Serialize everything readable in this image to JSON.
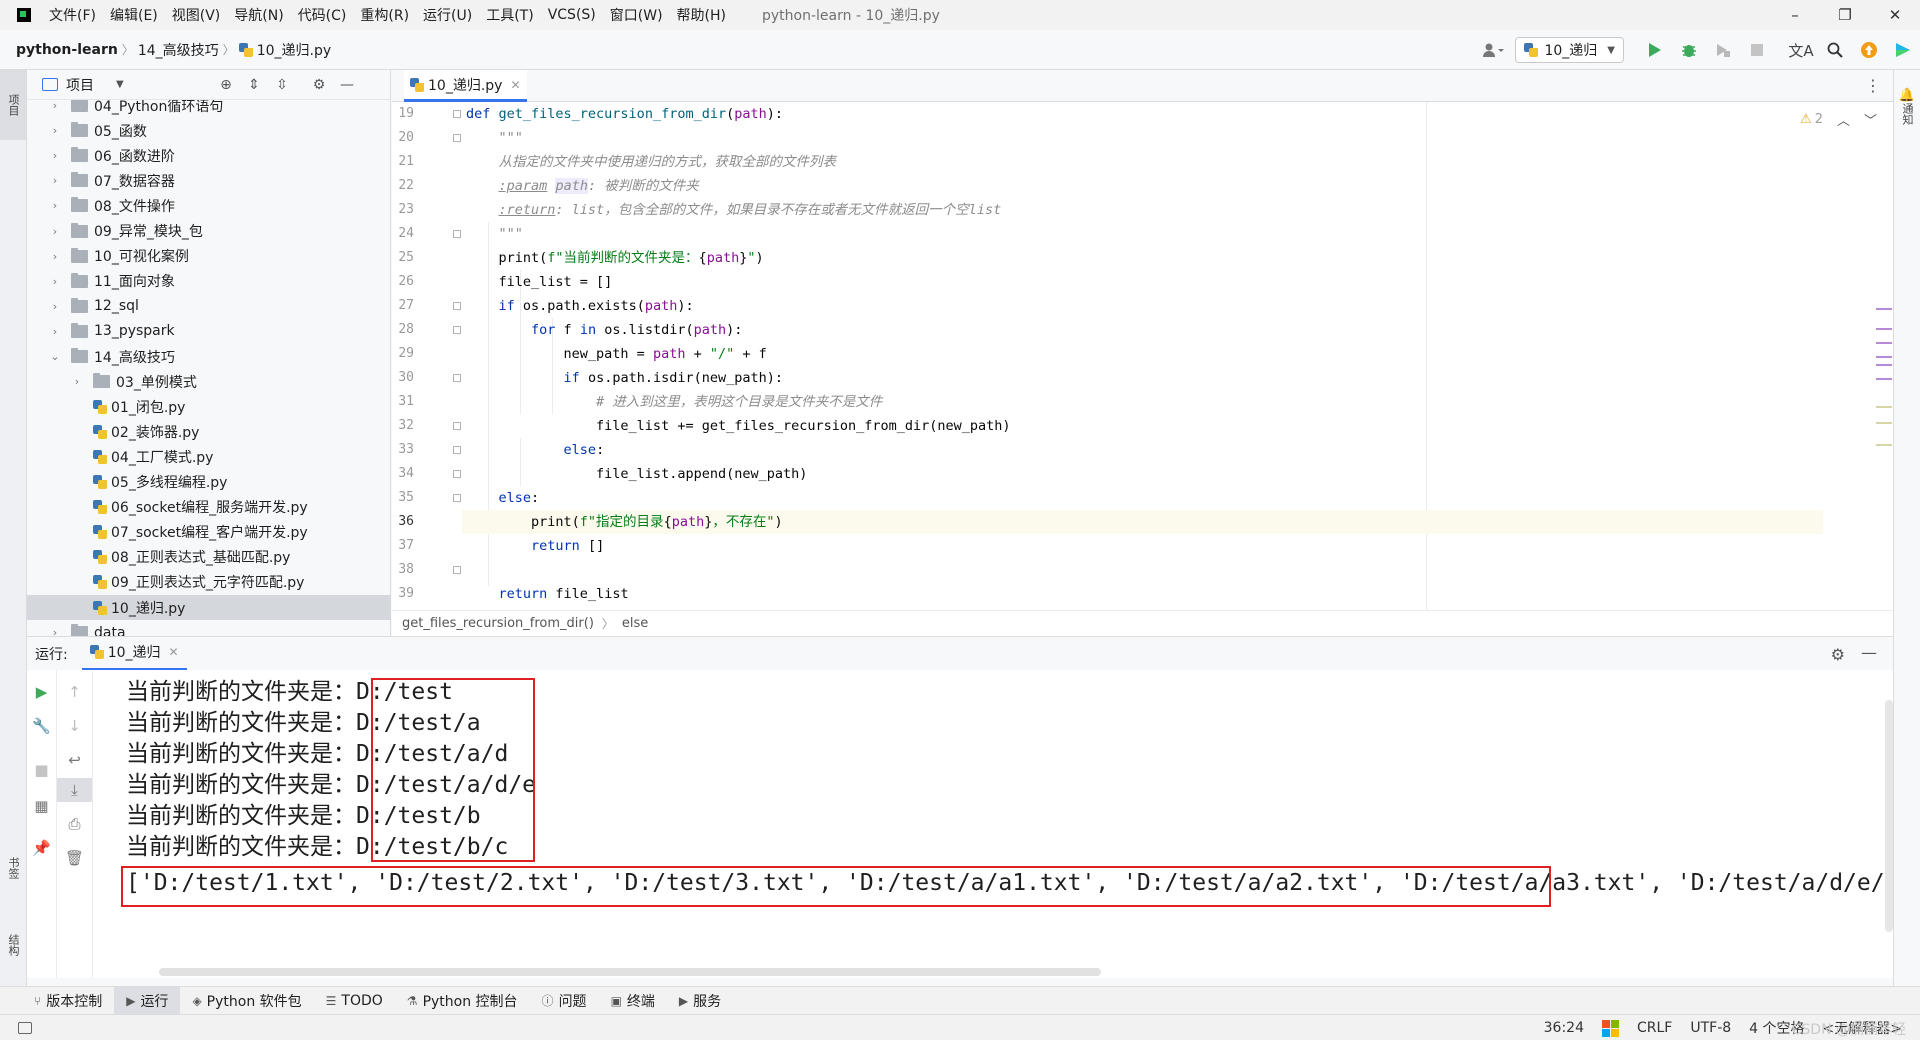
{
  "window": {
    "title": "python-learn - 10_递归.py",
    "menu": [
      "文件(F)",
      "编辑(E)",
      "视图(V)",
      "导航(N)",
      "代码(C)",
      "重构(R)",
      "运行(U)",
      "工具(T)",
      "VCS(S)",
      "窗口(W)",
      "帮助(H)"
    ],
    "controls": [
      "–",
      "❐",
      "✕"
    ]
  },
  "nav": {
    "breadcrumbs": [
      "python-learn",
      "14_高级技巧",
      "10_递归.py"
    ],
    "run_config": "10_递归"
  },
  "colors": {
    "accent": "#3574f0",
    "run_green": "#3da95b",
    "highlight_box": "#e02020"
  },
  "project": {
    "title": "项目",
    "tree": [
      {
        "label": "04_Python循环语句",
        "type": "folder",
        "depth": 0,
        "expanded": false
      },
      {
        "label": "05_函数",
        "type": "folder",
        "depth": 0,
        "expanded": false
      },
      {
        "label": "06_函数进阶",
        "type": "folder",
        "depth": 0,
        "expanded": false
      },
      {
        "label": "07_数据容器",
        "type": "folder",
        "depth": 0,
        "expanded": false
      },
      {
        "label": "08_文件操作",
        "type": "folder",
        "depth": 0,
        "expanded": false
      },
      {
        "label": "09_异常_模块_包",
        "type": "folder",
        "depth": 0,
        "expanded": false
      },
      {
        "label": "10_可视化案例",
        "type": "folder",
        "depth": 0,
        "expanded": false
      },
      {
        "label": "11_面向对象",
        "type": "folder",
        "depth": 0,
        "expanded": false
      },
      {
        "label": "12_sql",
        "type": "folder",
        "depth": 0,
        "expanded": false
      },
      {
        "label": "13_pyspark",
        "type": "folder",
        "depth": 0,
        "expanded": false
      },
      {
        "label": "14_高级技巧",
        "type": "folder",
        "depth": 0,
        "expanded": true
      },
      {
        "label": "03_单例模式",
        "type": "folder",
        "depth": 1,
        "expanded": false
      },
      {
        "label": "01_闭包.py",
        "type": "file",
        "depth": 1
      },
      {
        "label": "02_装饰器.py",
        "type": "file",
        "depth": 1
      },
      {
        "label": "04_工厂模式.py",
        "type": "file",
        "depth": 1
      },
      {
        "label": "05_多线程编程.py",
        "type": "file",
        "depth": 1
      },
      {
        "label": "06_socket编程_服务端开发.py",
        "type": "file",
        "depth": 1
      },
      {
        "label": "07_socket编程_客户端开发.py",
        "type": "file",
        "depth": 1
      },
      {
        "label": "08_正则表达式_基础匹配.py",
        "type": "file",
        "depth": 1
      },
      {
        "label": "09_正则表达式_元字符匹配.py",
        "type": "file",
        "depth": 1
      },
      {
        "label": "10_递归.py",
        "type": "file",
        "depth": 1,
        "selected": true
      },
      {
        "label": "data",
        "type": "folder",
        "depth": 0,
        "expanded": false
      }
    ]
  },
  "editor": {
    "tab": "10_递归.py",
    "inspection_count": "2",
    "current_line": "36",
    "line_numbers": [
      "19",
      "20",
      "21",
      "22",
      "23",
      "24",
      "25",
      "26",
      "27",
      "28",
      "29",
      "30",
      "31",
      "32",
      "33",
      "34",
      "35",
      "36",
      "37",
      "38",
      "39"
    ],
    "breadcrumb": [
      "get_files_recursion_from_dir()",
      "else"
    ]
  },
  "run": {
    "label": "运行:",
    "tab": "10_递归",
    "output": [
      {
        "prefix": "当前判断的文件夹是：",
        "path": "D:/test"
      },
      {
        "prefix": "当前判断的文件夹是：",
        "path": "D:/test/a"
      },
      {
        "prefix": "当前判断的文件夹是：",
        "path": "D:/test/a/d"
      },
      {
        "prefix": "当前判断的文件夹是：",
        "path": "D:/test/a/d/e"
      },
      {
        "prefix": "当前判断的文件夹是：",
        "path": "D:/test/b"
      },
      {
        "prefix": "当前判断的文件夹是：",
        "path": "D:/test/b/c"
      }
    ],
    "result": "['D:/test/1.txt', 'D:/test/2.txt', 'D:/test/3.txt', 'D:/test/a/a1.txt', 'D:/test/a/a2.txt', 'D:/test/a/a3.txt', 'D:/test/a/d/e/"
  },
  "left_stripe": {
    "project_tab": "项目",
    "bookmarks_tab": "书签",
    "structure_tab": "结构"
  },
  "right_stripe": {
    "notifications_tab": "通知"
  },
  "toolwindows": [
    {
      "label": "版本控制",
      "icon": "branch-icon"
    },
    {
      "label": "运行",
      "icon": "play-icon",
      "active": true
    },
    {
      "label": "Python 软件包",
      "icon": "layers-icon"
    },
    {
      "label": "TODO",
      "icon": "list-icon"
    },
    {
      "label": "Python 控制台",
      "icon": "python-icon"
    },
    {
      "label": "问题",
      "icon": "info-icon"
    },
    {
      "label": "终端",
      "icon": "terminal-icon"
    },
    {
      "label": "服务",
      "icon": "services-icon"
    }
  ],
  "status": {
    "position": "36:24",
    "line_separator": "CRLF",
    "encoding": "UTF-8",
    "indent": "4 个空格",
    "interpreter": "<无解释器>",
    "watermark": "CSDN @楠楠年轻"
  }
}
